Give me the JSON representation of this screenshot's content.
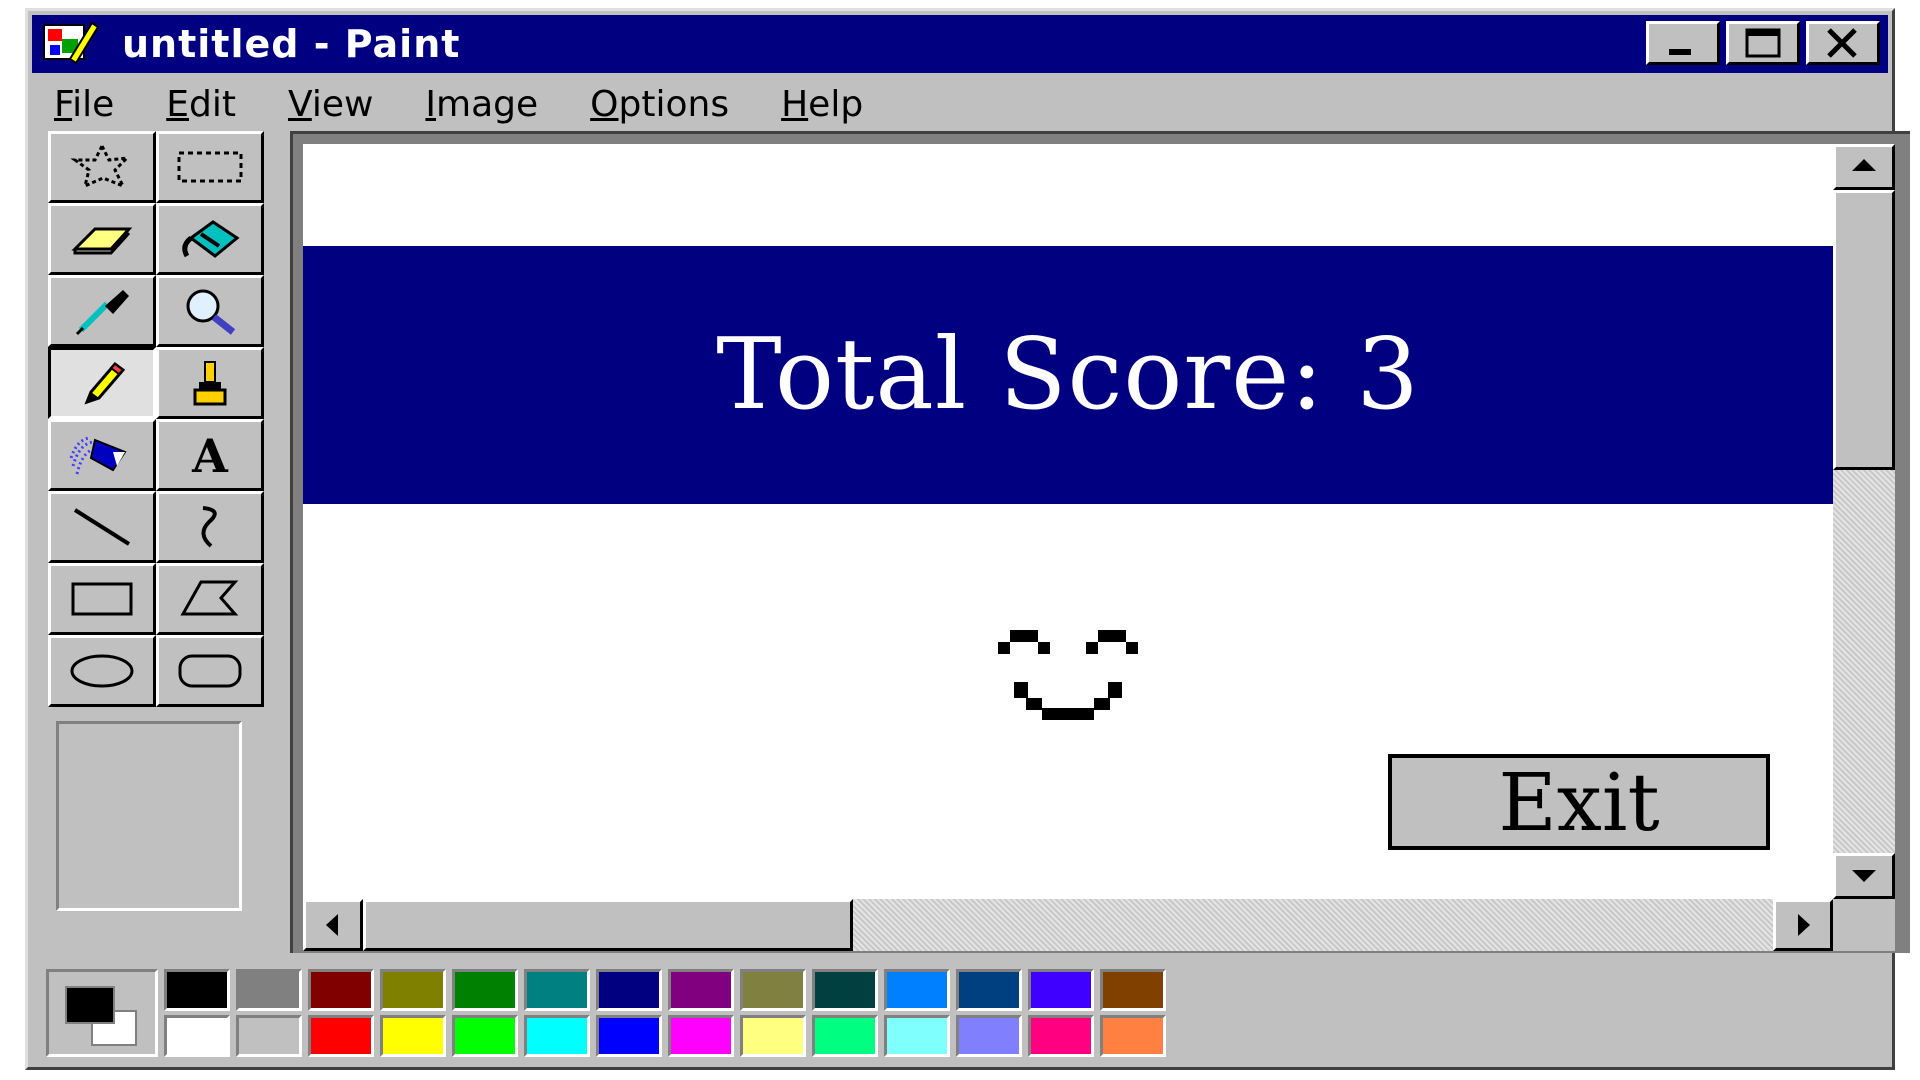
{
  "window": {
    "title": "untitled - Paint",
    "app_icon": "paint-app-icon",
    "controls": [
      {
        "name": "minimize-button",
        "icon": "minimize-icon"
      },
      {
        "name": "maximize-button",
        "icon": "maximize-icon"
      },
      {
        "name": "close-button",
        "icon": "close-icon"
      }
    ]
  },
  "menu": [
    {
      "accel": "F",
      "rest": "ile"
    },
    {
      "accel": "E",
      "rest": "dit"
    },
    {
      "accel": "V",
      "rest": "iew"
    },
    {
      "accel": "I",
      "rest": "mage"
    },
    {
      "accel": "O",
      "rest": "ptions"
    },
    {
      "accel": "H",
      "rest": "elp"
    }
  ],
  "tools": [
    {
      "name": "free-form-select-tool",
      "icon": "free-form-select-icon"
    },
    {
      "name": "select-tool",
      "icon": "rect-select-icon"
    },
    {
      "name": "eraser-tool",
      "icon": "eraser-icon"
    },
    {
      "name": "fill-tool",
      "icon": "paint-bucket-icon"
    },
    {
      "name": "pick-color-tool",
      "icon": "eyedropper-icon"
    },
    {
      "name": "magnifier-tool",
      "icon": "magnifier-icon"
    },
    {
      "name": "pencil-tool",
      "icon": "pencil-icon",
      "active": true
    },
    {
      "name": "brush-tool",
      "icon": "brush-icon"
    },
    {
      "name": "airbrush-tool",
      "icon": "airbrush-icon"
    },
    {
      "name": "text-tool",
      "icon": "text-icon",
      "glyph": "A"
    },
    {
      "name": "line-tool",
      "icon": "line-icon"
    },
    {
      "name": "curve-tool",
      "icon": "curve-icon"
    },
    {
      "name": "rectangle-tool",
      "icon": "rectangle-icon"
    },
    {
      "name": "polygon-tool",
      "icon": "polygon-icon"
    },
    {
      "name": "ellipse-tool",
      "icon": "ellipse-icon"
    },
    {
      "name": "rounded-rectangle-tool",
      "icon": "rounded-rectangle-icon"
    }
  ],
  "canvas": {
    "score_label": "Total Score: 3",
    "face": "smiley-face",
    "exit_label": "Exit",
    "banner_color": "#000080"
  },
  "palette": {
    "foreground": "#000000",
    "background": "#ffffff",
    "top_row": [
      "#000000",
      "#808080",
      "#800000",
      "#808000",
      "#008000",
      "#008080",
      "#000080",
      "#800080",
      "#808040",
      "#004040",
      "#0080ff",
      "#004080",
      "#4000ff",
      "#804000"
    ],
    "bottom_row": [
      "#ffffff",
      "#c0c0c0",
      "#ff0000",
      "#ffff00",
      "#00ff00",
      "#00ffff",
      "#0000ff",
      "#ff00ff",
      "#ffff80",
      "#00ff80",
      "#80ffff",
      "#8080ff",
      "#ff0080",
      "#ff8040"
    ]
  }
}
